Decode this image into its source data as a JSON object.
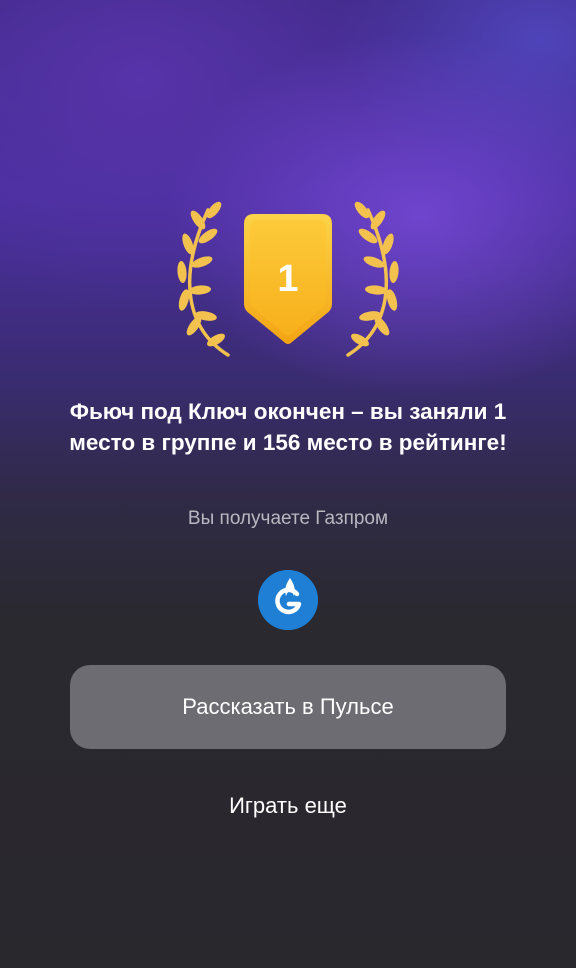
{
  "trophy": {
    "place": "1",
    "icon": "laurel-wreath-icon",
    "badge_color": "#f6b820",
    "laurel_color": "#f2c14e"
  },
  "result": {
    "headline": "Фьюч под Ключ окончен – вы заняли 1 место в группе и 156 место в рейтинге!",
    "reward_text": "Вы получаете Газпром",
    "reward_icon": "gazprom-logo-icon",
    "reward_icon_color": "#1e7fd4"
  },
  "actions": {
    "share_label": "Рассказать в Пульсе",
    "play_again_label": "Играть еще"
  }
}
